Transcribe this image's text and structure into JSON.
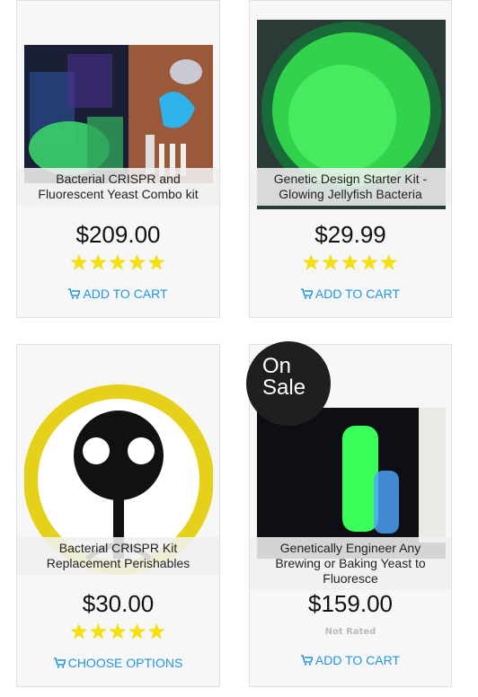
{
  "products": [
    {
      "title": "Bacterial CRISPR and Fluorescent Yeast Combo kit",
      "price": "$209.00",
      "rating": 5,
      "rating_text": "★★★★★",
      "action": "ADD TO CART",
      "action_icon": "cart-icon"
    },
    {
      "title": "Genetic Design Starter Kit - Glowing Jellyfish Bacteria",
      "price": "$29.99",
      "rating": 5,
      "rating_text": "★★★★★",
      "action": "ADD TO CART",
      "action_icon": "cart-icon"
    },
    {
      "title": "Bacterial CRISPR Kit Replacement Perishables",
      "price": "$30.00",
      "rating": 5,
      "rating_text": "★★★★★",
      "action": "CHOOSE OPTIONS",
      "action_icon": "cart-icon"
    },
    {
      "title": "Genetically Engineer Any Brewing or Baking Yeast to Fluoresce",
      "price": "$159.00",
      "rating_status": "Not Rated",
      "action": "ADD TO CART",
      "action_icon": "cart-icon",
      "badge": {
        "line1": "On",
        "line2": "Sale"
      }
    }
  ],
  "colors": {
    "link": "#2196d9",
    "star": "#f5e200",
    "glow_green": "#39ff5a"
  }
}
